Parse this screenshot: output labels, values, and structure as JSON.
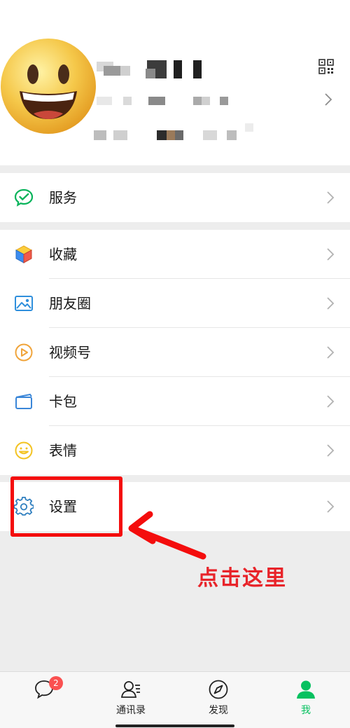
{
  "menu_groups": [
    {
      "items": [
        {
          "label": "服务",
          "icon": "wechat-pay-icon"
        }
      ]
    },
    {
      "items": [
        {
          "label": "收藏",
          "icon": "cube-icon"
        },
        {
          "label": "朋友圈",
          "icon": "image-icon"
        },
        {
          "label": "视频号",
          "icon": "play-circle-icon"
        },
        {
          "label": "卡包",
          "icon": "card-icon"
        },
        {
          "label": "表情",
          "icon": "smiley-icon"
        }
      ]
    },
    {
      "items": [
        {
          "label": "设置",
          "icon": "gear-icon"
        }
      ]
    }
  ],
  "annotation": {
    "text": "点击这里",
    "color": "#e8242a"
  },
  "tabbar": {
    "tabs": [
      {
        "label": "",
        "icon": "chat-bubble-icon",
        "badge": "2"
      },
      {
        "label": "通讯录",
        "icon": "contacts-icon"
      },
      {
        "label": "发现",
        "icon": "compass-icon"
      },
      {
        "label": "我",
        "icon": "person-icon",
        "active": true
      }
    ],
    "active_color": "#07c160"
  }
}
